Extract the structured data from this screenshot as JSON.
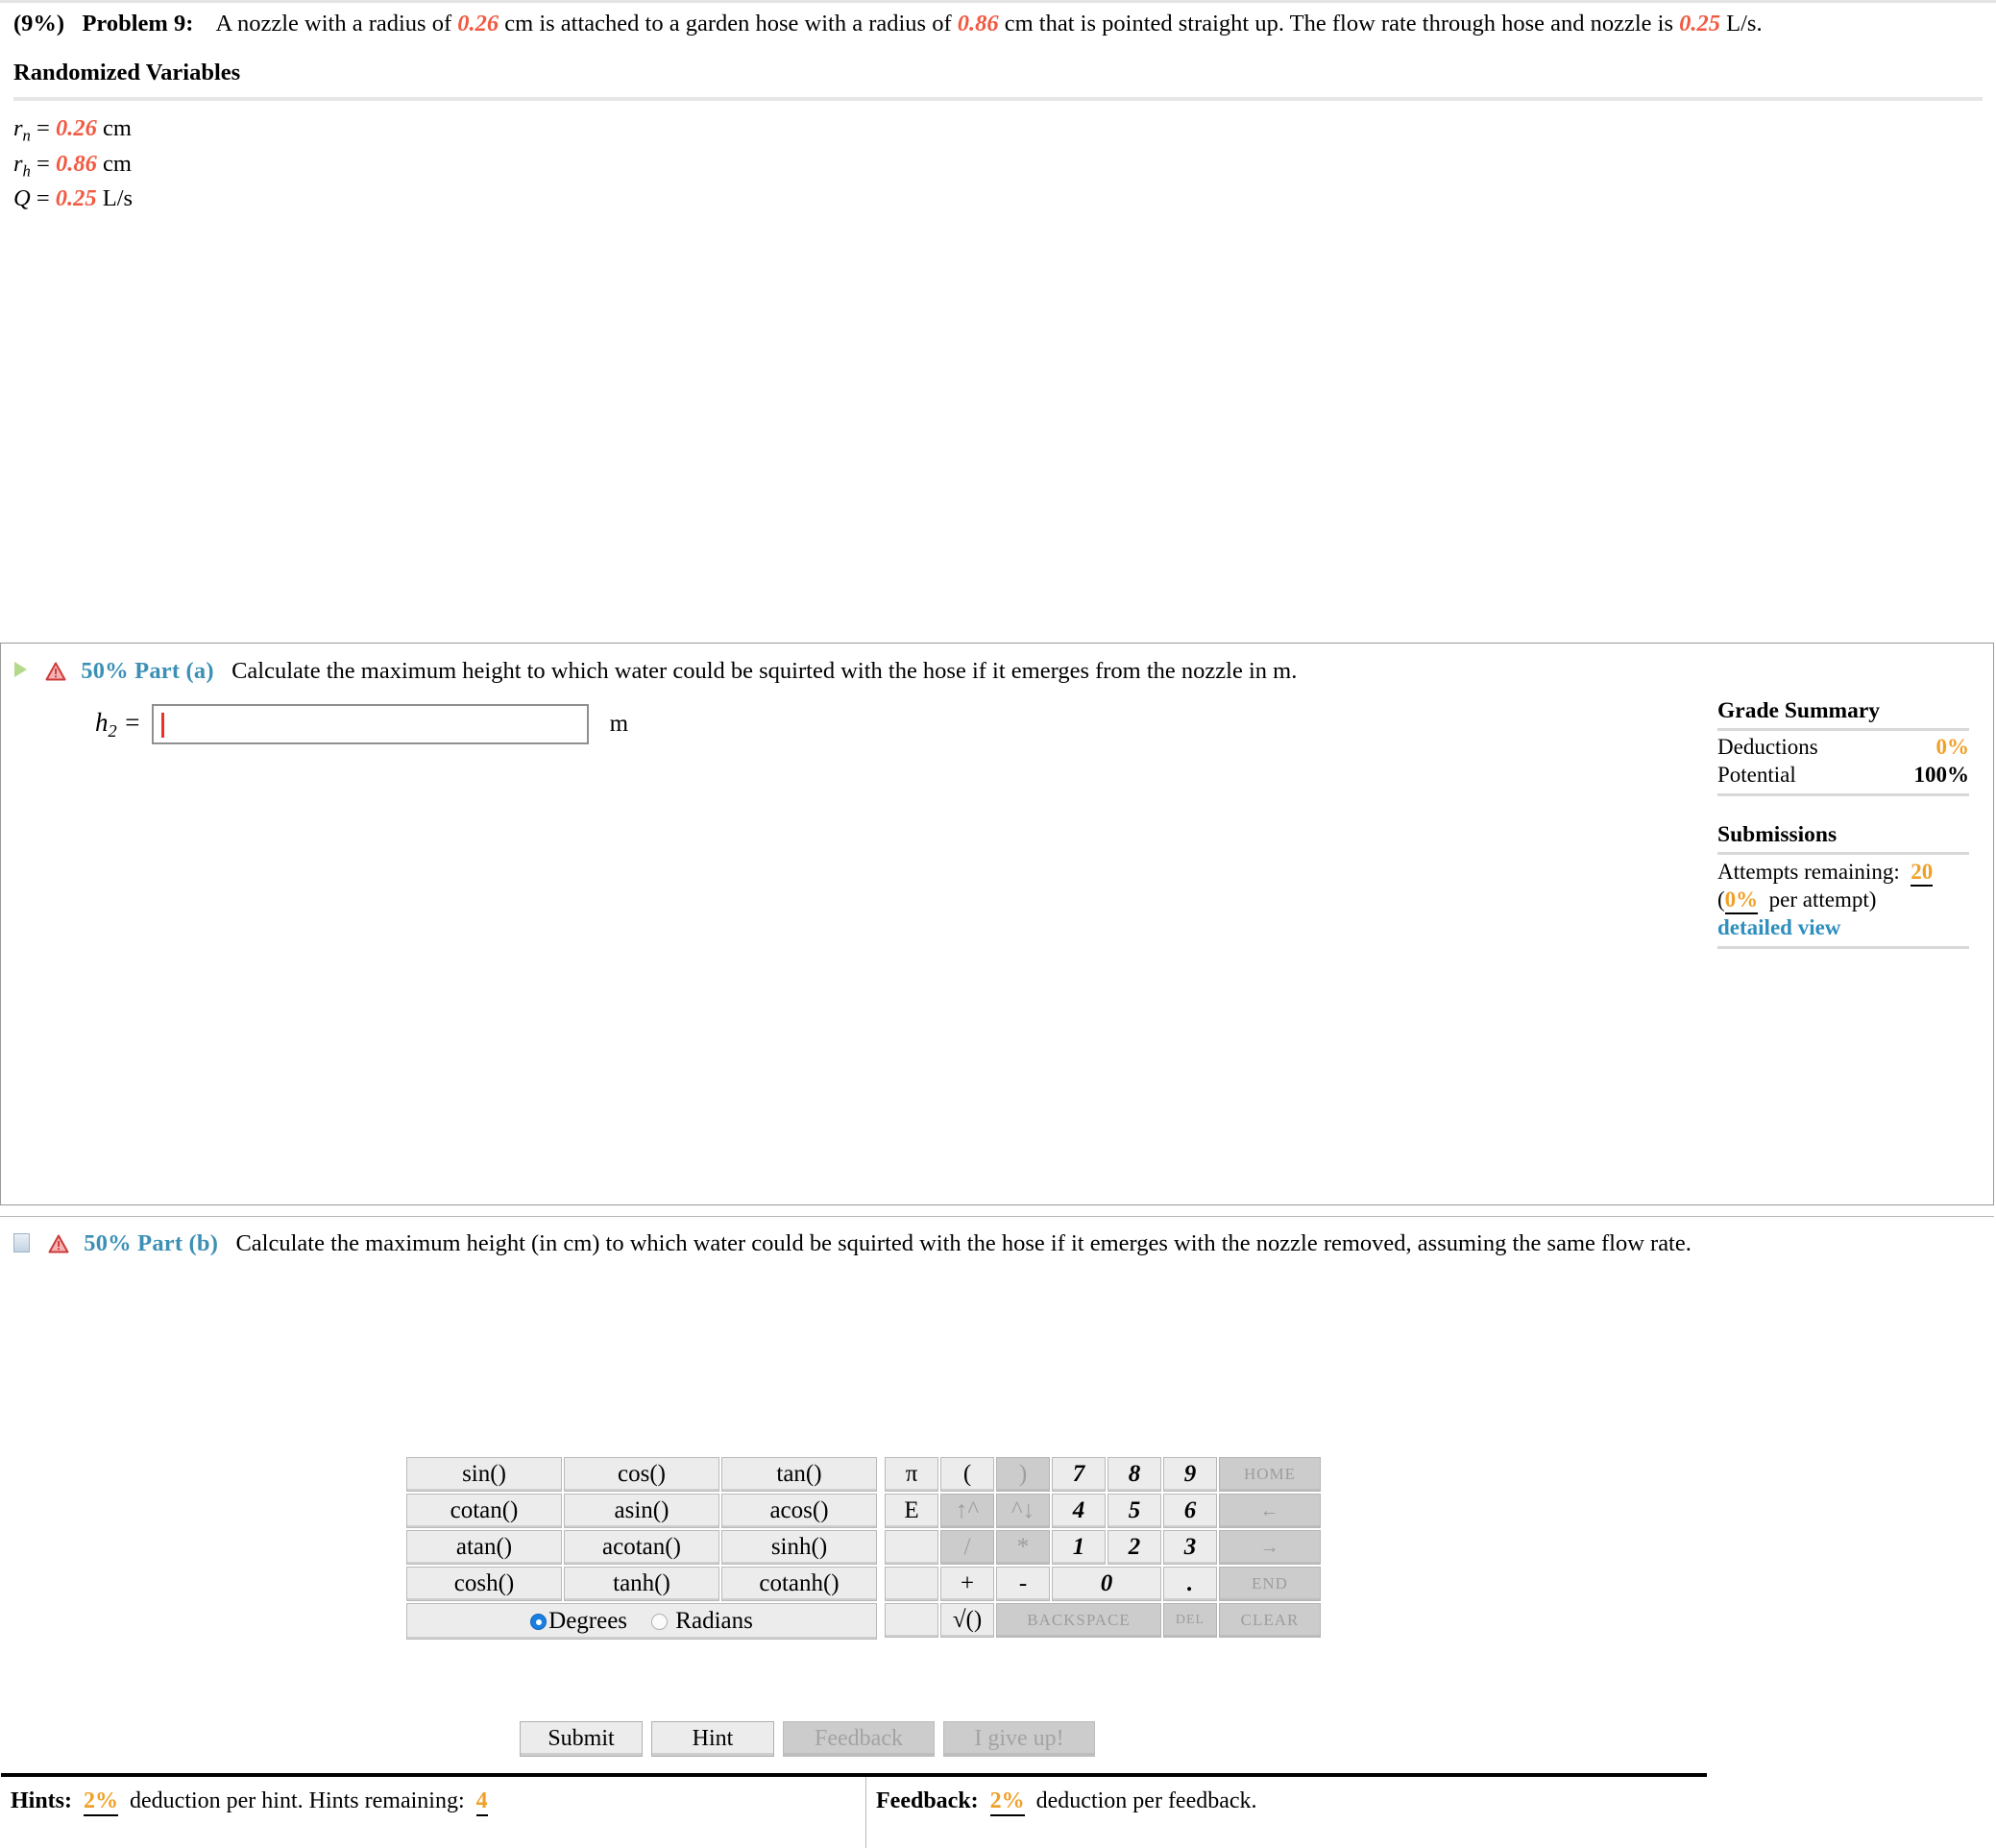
{
  "problem": {
    "percent": "(9%)",
    "label": "Problem 9:",
    "text_1": "A nozzle with a radius of",
    "r_nozzle": "0.26",
    "text_2": "cm is attached to a garden hose with a radius of",
    "r_hose": "0.86",
    "text_3": "cm that is pointed straight up. The flow rate through hose and nozzle is",
    "flow": "0.25",
    "text_4": "L/s."
  },
  "randomized_variables": {
    "title": "Randomized Variables",
    "rows": [
      {
        "symbol": "r",
        "subscript": "n",
        "eq": "=",
        "value": "0.26",
        "unit": "cm"
      },
      {
        "symbol": "r",
        "subscript": "h",
        "eq": "=",
        "value": "0.86",
        "unit": "cm"
      },
      {
        "symbol": "Q",
        "subscript": "",
        "eq": "=",
        "value": "0.25",
        "unit": "L/s"
      }
    ]
  },
  "part_a": {
    "weight": "50% Part (a)",
    "prompt": "Calculate the maximum height to which water could be squirted with the hose if it emerges from the nozzle in m.",
    "answer": {
      "variable": "h",
      "subscript": "2",
      "equals": "=",
      "value": "",
      "unit": "m"
    },
    "expand_icon": "play-triangle-icon",
    "status_icon": "warning-triangle-icon"
  },
  "calculator": {
    "functions": [
      [
        "sin()",
        "cos()",
        "tan()"
      ],
      [
        "cotan()",
        "asin()",
        "acos()"
      ],
      [
        "atan()",
        "acotan()",
        "sinh()"
      ],
      [
        "cosh()",
        "tanh()",
        "cotanh()"
      ]
    ],
    "angle_mode": {
      "degrees_label": "Degrees",
      "radians_label": "Radians",
      "selected": "Degrees"
    },
    "keypad": [
      [
        {
          "label": "π",
          "enabled": true
        },
        {
          "label": "(",
          "enabled": true
        },
        {
          "label": ")",
          "enabled": false
        },
        {
          "label": "7",
          "enabled": true
        },
        {
          "label": "8",
          "enabled": true
        },
        {
          "label": "9",
          "enabled": true
        },
        {
          "label": "HOME",
          "enabled": false
        }
      ],
      [
        {
          "label": "E",
          "enabled": true
        },
        {
          "label": "↑^",
          "enabled": false
        },
        {
          "label": "^↓",
          "enabled": false
        },
        {
          "label": "4",
          "enabled": true
        },
        {
          "label": "5",
          "enabled": true
        },
        {
          "label": "6",
          "enabled": true
        },
        {
          "label": "←",
          "enabled": false
        }
      ],
      [
        {
          "label": "",
          "enabled": true
        },
        {
          "label": "/",
          "enabled": false
        },
        {
          "label": "*",
          "enabled": false
        },
        {
          "label": "1",
          "enabled": true
        },
        {
          "label": "2",
          "enabled": true
        },
        {
          "label": "3",
          "enabled": true
        },
        {
          "label": "→",
          "enabled": false
        }
      ],
      [
        {
          "label": "",
          "enabled": true
        },
        {
          "label": "+",
          "enabled": true
        },
        {
          "label": "-",
          "enabled": true
        },
        {
          "label": "0",
          "enabled": true
        },
        {
          "label": ".",
          "enabled": true
        },
        {
          "label": "END",
          "enabled": false
        }
      ],
      [
        {
          "label": "",
          "enabled": true
        },
        {
          "label": "√()",
          "enabled": true
        },
        {
          "label": "BACKSPACE",
          "enabled": false
        },
        {
          "label": "DEL",
          "enabled": false
        },
        {
          "label": "CLEAR",
          "enabled": false
        }
      ]
    ]
  },
  "actions": {
    "submit": "Submit",
    "hint": "Hint",
    "feedback": "Feedback",
    "give_up": "I give up!"
  },
  "hints_bar": {
    "hints_label": "Hints:",
    "hints_deduction": "2%",
    "hints_text": "deduction per hint. Hints remaining:",
    "hints_remaining": "4",
    "feedback_label": "Feedback:",
    "feedback_deduction": "2%",
    "feedback_text": "deduction per feedback."
  },
  "grade_summary": {
    "title": "Grade Summary",
    "deductions_label": "Deductions",
    "deductions_value": "0%",
    "potential_label": "Potential",
    "potential_value": "100%"
  },
  "submissions": {
    "title": "Submissions",
    "attempts_label": "Attempts remaining:",
    "attempts_value": "20",
    "per_attempt_value": "0%",
    "per_attempt_suffix": "per attempt)",
    "per_attempt_prefix": "(",
    "detailed_view": "detailed view"
  },
  "part_b": {
    "weight": "50% Part (b)",
    "prompt": "Calculate the maximum height (in cm) to which water could be squirted with the hose if it emerges with the nozzle removed, assuming the same flow rate.",
    "expand_icon": "collapsed-square-icon",
    "status_icon": "warning-triangle-icon"
  },
  "colors": {
    "accent_orange": "#f15a42",
    "link_blue": "#3c90b5",
    "grade_orange": "#f0a028",
    "caret_red": "#ec3323"
  }
}
